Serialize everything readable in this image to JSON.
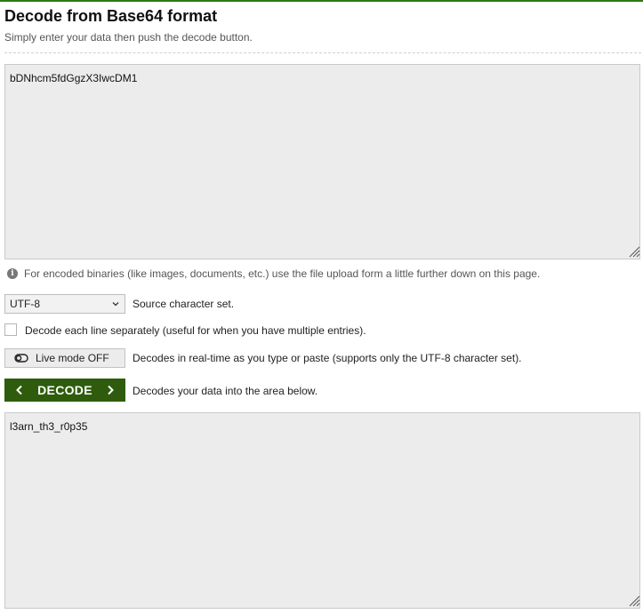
{
  "header": {
    "title": "Decode from Base64 format",
    "subtitle": "Simply enter your data then push the decode button."
  },
  "input": {
    "value": "bDNhcm5fdGgzX3IwcDM1"
  },
  "info": {
    "text": "For encoded binaries (like images, documents, etc.) use the file upload form a little further down on this page."
  },
  "charset": {
    "selected": "UTF-8",
    "label": "Source character set."
  },
  "separate_lines": {
    "checked": false,
    "label": "Decode each line separately (useful for when you have multiple entries)."
  },
  "live_mode": {
    "button_label": "Live mode OFF",
    "description": "Decodes in real-time as you type or paste (supports only the UTF-8 character set)."
  },
  "decode": {
    "button_label": "DECODE",
    "description": "Decodes your data into the area below."
  },
  "output": {
    "value": "l3arn_th3_r0p35"
  },
  "colors": {
    "accent": "#2c7a12",
    "decode_button": "#2e5c0c",
    "textarea_bg": "#ececec"
  }
}
